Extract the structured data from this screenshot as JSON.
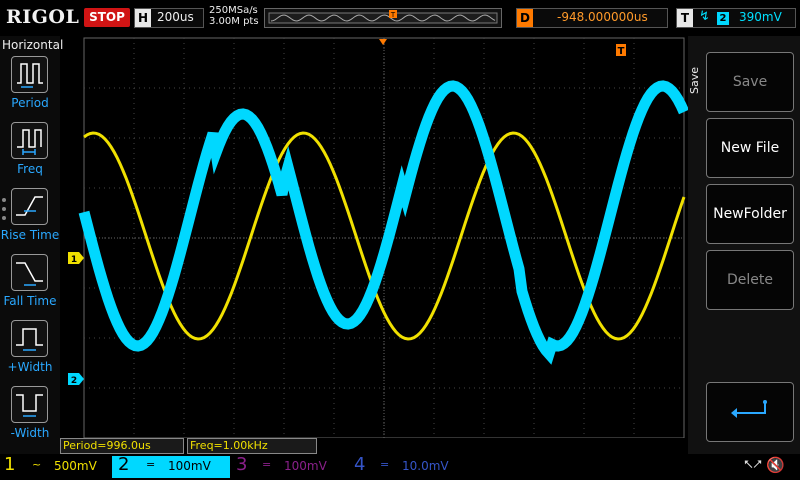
{
  "header": {
    "brand": "RIGOL",
    "run_status": "STOP",
    "timebase_key": "H",
    "timebase_value": "200us",
    "sample_rate": "250MSa/s",
    "memory_depth": "3.00M pts",
    "delay_key": "D",
    "delay_value": "-948.000000us",
    "trigger_key": "T",
    "trigger_source": "2",
    "trigger_level": "390mV"
  },
  "left_menu": {
    "title": "Horizontal",
    "items": [
      {
        "label": "Period",
        "icon": "period-icon"
      },
      {
        "label": "Freq",
        "icon": "freq-icon"
      },
      {
        "label": "Rise Time",
        "icon": "rise-time-icon"
      },
      {
        "label": "Fall Time",
        "icon": "fall-time-icon"
      },
      {
        "label": "+Width",
        "icon": "positive-width-icon"
      },
      {
        "label": "-Width",
        "icon": "negative-width-icon"
      }
    ]
  },
  "right_menu": {
    "title": "Save",
    "buttons": [
      {
        "label": "Save",
        "enabled": false
      },
      {
        "label": "New File",
        "enabled": true
      },
      {
        "label": "NewFolder",
        "enabled": true
      },
      {
        "label": "Delete",
        "enabled": false
      }
    ],
    "back_icon": "return-arrow-icon"
  },
  "measurements": {
    "period": "Period=996.0us",
    "freq": "Freq=1.00kHz"
  },
  "markers": {
    "ch1": "1",
    "ch2": "2",
    "trigger_top": "T",
    "trigger_right": "T"
  },
  "channels": [
    {
      "num": "1",
      "coupling": "~",
      "scale": "500mV",
      "color": "#f0e000",
      "active": false
    },
    {
      "num": "2",
      "coupling": "=",
      "scale": "100mV",
      "color": "#00d8ff",
      "active": true
    },
    {
      "num": "3",
      "coupling": "=",
      "scale": "100mV",
      "color": "#b000b0",
      "active": false
    },
    {
      "num": "4",
      "coupling": "=",
      "scale": "10.0mV",
      "color": "#3060ff",
      "active": false
    }
  ],
  "colors": {
    "ch1": "#f0e000",
    "ch2": "#00d8ff",
    "trigger": "#ff7a00",
    "grid": "#555555"
  },
  "status_icons": [
    "usb-icon",
    "speaker-muted-icon"
  ]
}
